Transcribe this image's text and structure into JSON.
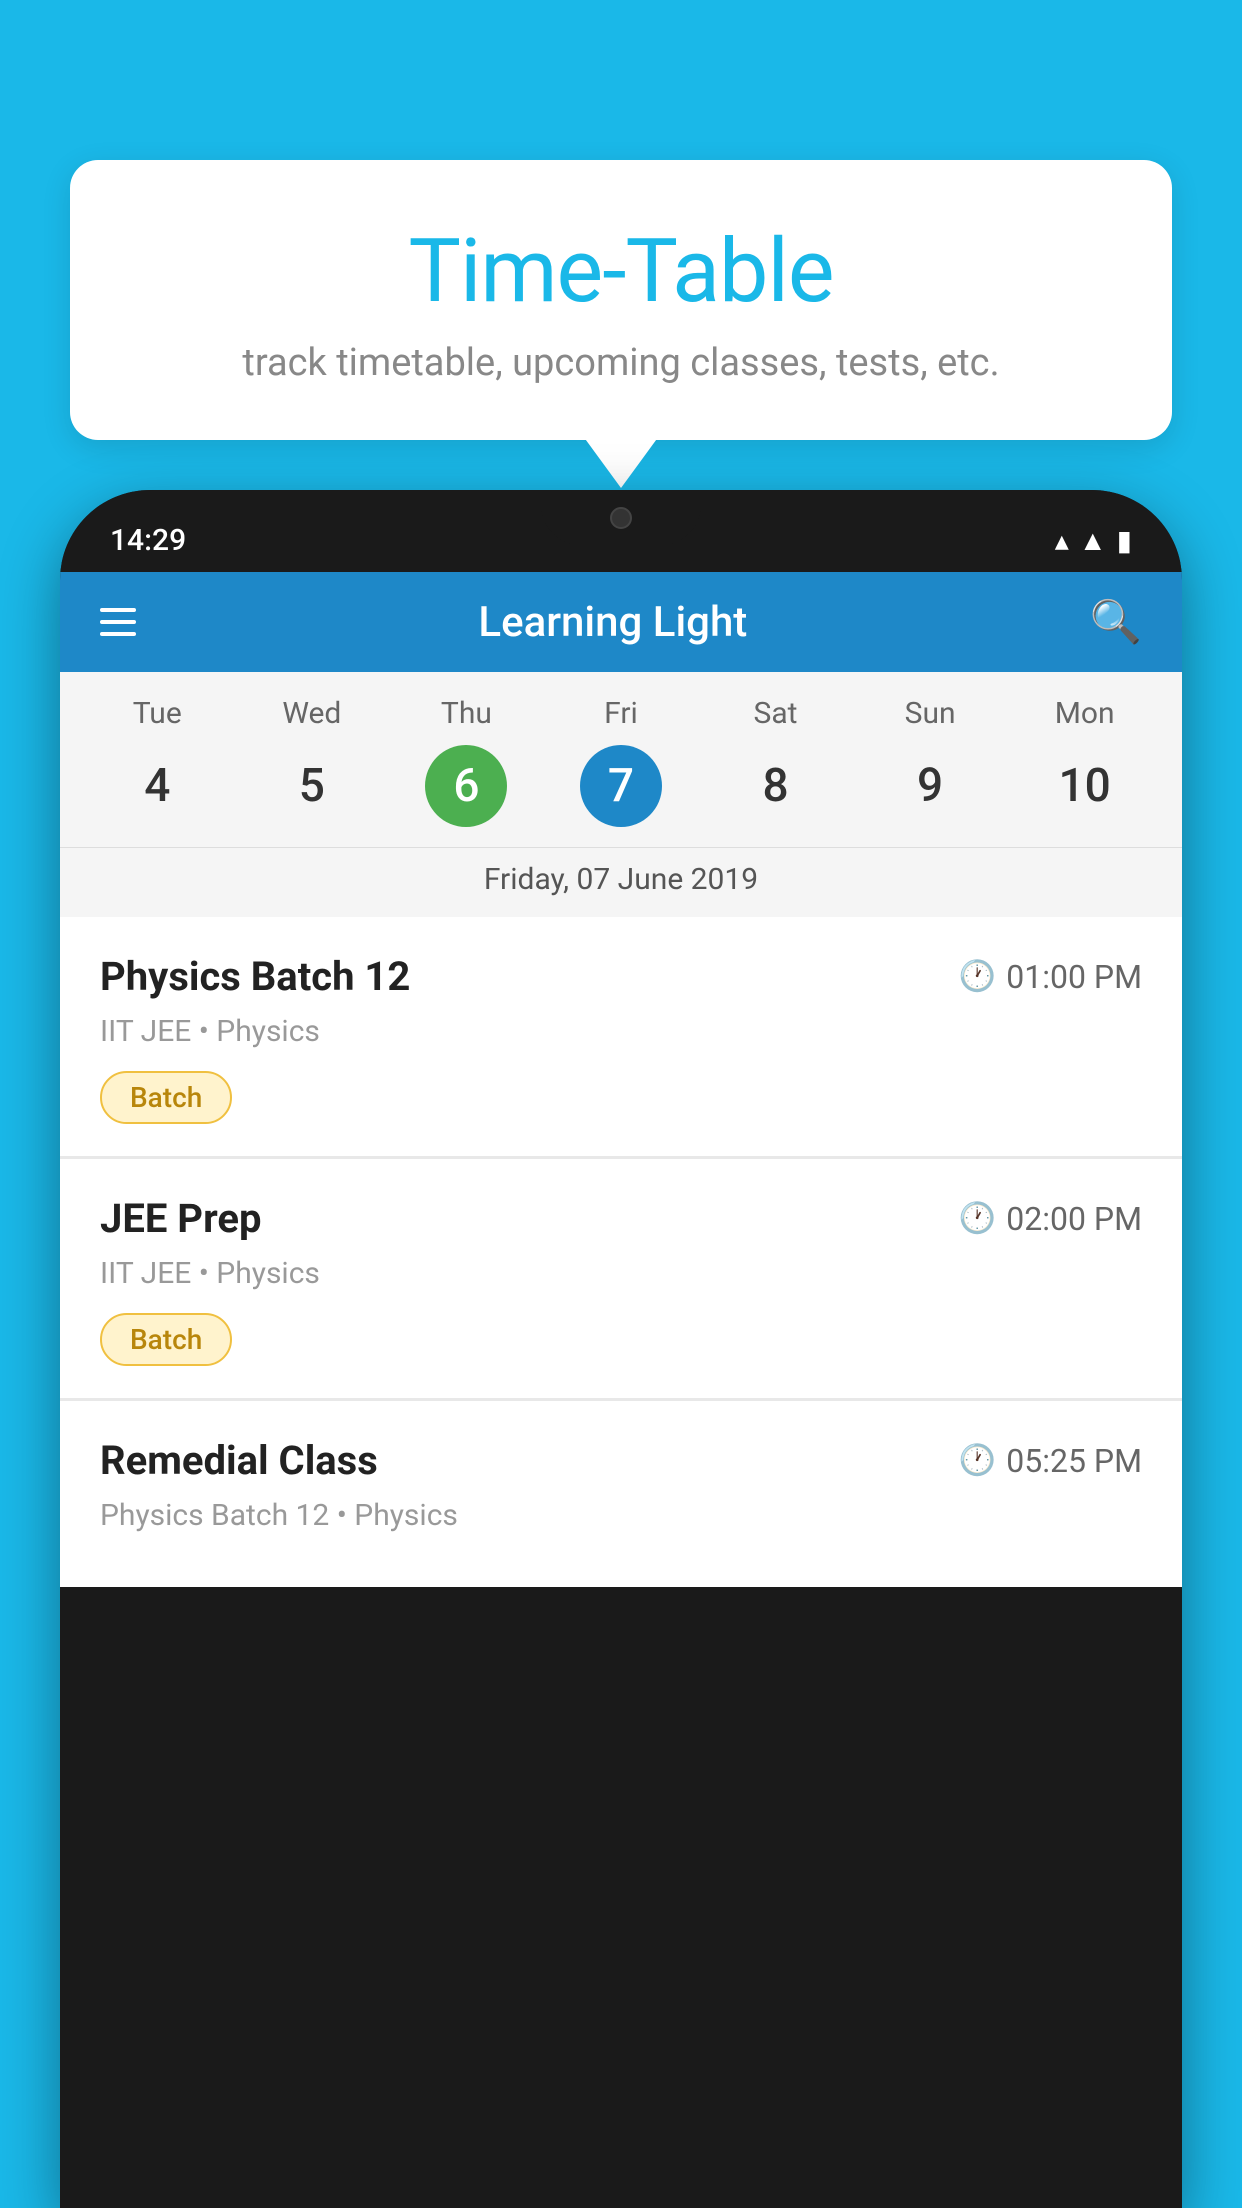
{
  "tooltip": {
    "title": "Time-Table",
    "subtitle": "track timetable, upcoming classes, tests, etc."
  },
  "status_bar": {
    "time": "14:29"
  },
  "app_header": {
    "title": "Learning Light"
  },
  "calendar": {
    "days": [
      {
        "name": "Tue",
        "num": "4",
        "state": "normal"
      },
      {
        "name": "Wed",
        "num": "5",
        "state": "normal"
      },
      {
        "name": "Thu",
        "num": "6",
        "state": "today"
      },
      {
        "name": "Fri",
        "num": "7",
        "state": "selected"
      },
      {
        "name": "Sat",
        "num": "8",
        "state": "normal"
      },
      {
        "name": "Sun",
        "num": "9",
        "state": "normal"
      },
      {
        "name": "Mon",
        "num": "10",
        "state": "normal"
      }
    ],
    "selected_date_label": "Friday, 07 June 2019"
  },
  "classes": [
    {
      "name": "Physics Batch 12",
      "time": "01:00 PM",
      "subtitle": "IIT JEE • Physics",
      "badge": "Batch"
    },
    {
      "name": "JEE Prep",
      "time": "02:00 PM",
      "subtitle": "IIT JEE • Physics",
      "badge": "Batch"
    },
    {
      "name": "Remedial Class",
      "time": "05:25 PM",
      "subtitle": "Physics Batch 12 • Physics",
      "badge": ""
    }
  ]
}
